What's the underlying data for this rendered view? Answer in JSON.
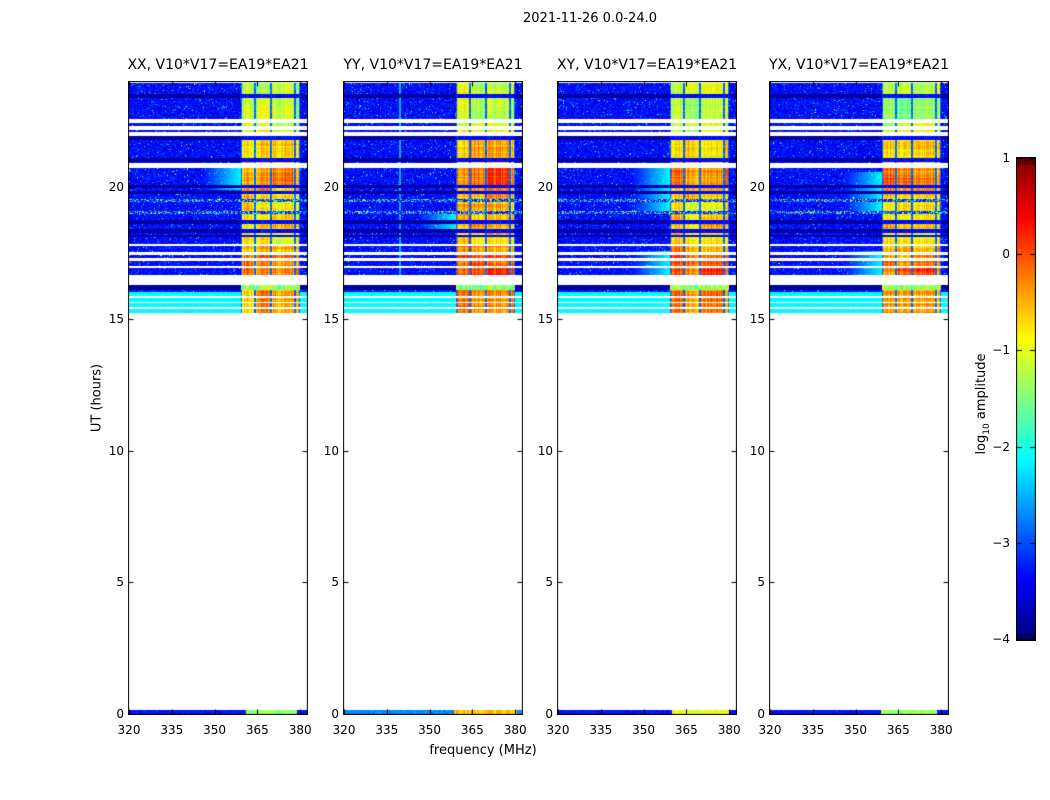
{
  "chart_data": {
    "type": "heatmap",
    "title": "2021-11-26 0.0-24.0",
    "xlabel": "frequency (MHz)",
    "ylabel": "UT (hours)",
    "panels": [
      {
        "label": "XX, V10*V17=EA19*EA21"
      },
      {
        "label": "YY, V10*V17=EA19*EA21"
      },
      {
        "label": "XY, V10*V17=EA19*EA21"
      },
      {
        "label": "YX, V10*V17=EA19*EA21"
      }
    ],
    "xlim": [
      320,
      382.4
    ],
    "ylim": [
      0,
      24
    ],
    "xticks": [
      320,
      335,
      350,
      365,
      380
    ],
    "yticks": [
      0,
      5,
      10,
      15,
      20
    ],
    "colorbar": {
      "label": "log10 amplitude",
      "lim": [
        -4,
        1
      ],
      "tick_values": [
        1,
        0,
        -1,
        -2,
        -3,
        -4
      ],
      "ticks": [
        "1",
        "0",
        "−1",
        "−2",
        "−3",
        "−4"
      ],
      "colormap": "jet"
    },
    "coverage_ut_hours": [
      [
        15.17,
        24.0
      ],
      [
        0,
        0.16
      ]
    ],
    "zero_hour_strip_ut": [
      0,
      0.15
    ],
    "rfi_band_mhz": [
      359.2,
      380.0
    ],
    "band_divider_mhz": [
      364.2,
      369.8,
      378.3
    ],
    "background_log_amp": -3.35,
    "white_gaps_ut": [
      [
        22.48,
        22.62
      ],
      [
        21.98,
        22.13
      ],
      [
        22.19,
        22.33
      ],
      [
        20.76,
        20.95
      ],
      [
        17.78,
        17.88
      ],
      [
        17.45,
        17.55
      ],
      [
        17.22,
        17.32
      ],
      [
        16.95,
        17.05
      ],
      [
        16.32,
        16.68
      ]
    ],
    "flagged_rows_ut": [
      [
        23.42,
        23.55
      ],
      [
        21.83,
        21.95
      ],
      [
        20.98,
        21.12
      ],
      [
        19.98,
        20.12
      ],
      [
        19.76,
        19.88
      ],
      [
        18.63,
        18.76
      ],
      [
        18.28,
        18.42
      ],
      [
        18.12,
        18.2
      ],
      [
        16.12,
        16.3
      ]
    ],
    "broadband_rfi_ut": [
      [
        19.47,
        19.58
      ],
      [
        19.0,
        19.12
      ]
    ],
    "striped_region_ut": [
      15.17,
      16.04
    ],
    "band_segments": [
      {
        "ut": [
          23.55,
          24.0
        ],
        "log_amp": -1.15
      },
      {
        "ut": [
          22.62,
          23.42
        ],
        "log_amp": -1.35
      },
      {
        "ut": [
          22.33,
          22.48
        ],
        "log_amp": -1.2
      },
      {
        "ut": [
          22.13,
          22.19
        ],
        "log_amp": -1.05
      },
      {
        "ut": [
          21.95,
          21.98
        ],
        "log_amp": -1.0
      },
      {
        "ut": [
          21.12,
          21.83
        ],
        "log_amp": -0.72
      },
      {
        "ut": [
          20.95,
          21.0
        ],
        "log_amp": -0.6
      },
      {
        "ut": [
          20.12,
          20.76
        ],
        "log_amp": -0.25
      },
      {
        "ut": [
          19.88,
          19.98
        ],
        "log_amp": -0.55
      },
      {
        "ut": [
          19.58,
          19.76
        ],
        "log_amp": -0.7
      },
      {
        "ut": [
          19.12,
          19.47
        ],
        "log_amp": -0.78
      },
      {
        "ut": [
          18.76,
          19.0
        ],
        "log_amp": -0.72
      },
      {
        "ut": [
          18.42,
          18.63
        ],
        "log_amp": -0.65
      },
      {
        "ut": [
          18.2,
          18.28
        ],
        "log_amp": -0.8
      },
      {
        "ut": [
          17.88,
          18.12
        ],
        "log_amp": -0.85
      },
      {
        "ut": [
          17.55,
          17.78
        ],
        "log_amp": -0.5
      },
      {
        "ut": [
          17.32,
          17.45
        ],
        "log_amp": -0.32
      },
      {
        "ut": [
          17.05,
          17.22
        ],
        "log_amp": -0.25
      },
      {
        "ut": [
          16.68,
          16.95
        ],
        "log_amp": -0.15
      },
      {
        "ut": [
          16.3,
          16.32
        ],
        "log_amp": -0.5
      },
      {
        "ut": [
          15.17,
          16.12
        ],
        "log_amp": -0.45
      },
      {
        "ut": [
          0,
          0.16
        ],
        "log_amp": -1.4
      }
    ],
    "panel_variants": [
      {
        "polarization": "XX",
        "band_adjust": 0,
        "vertical_streak_mhz": null,
        "bleed_ut": [
          [
            19.9,
            20.8
          ]
        ],
        "stripe_band_log_amp": -0.5,
        "strip0_band_mhz": [
          361,
          379
        ],
        "strip0_band_log_amp": -1.4,
        "strip0_bg_log_amp": -3.3
      },
      {
        "polarization": "YY",
        "band_adjust": 0.18,
        "vertical_streak_mhz": 339.7,
        "bleed_ut": [
          [
            18.4,
            19.0
          ]
        ],
        "stripe_band_log_amp": -0.2,
        "strip0_band_mhz": [
          358.5,
          380.5
        ],
        "strip0_band_log_amp": -0.55,
        "strip0_bg_log_amp": -2.7
      },
      {
        "polarization": "XY",
        "band_adjust": 0.05,
        "vertical_streak_mhz": null,
        "bleed_ut": [
          [
            19.0,
            20.8
          ],
          [
            16.68,
            17.6
          ]
        ],
        "stripe_band_log_amp": -0.35,
        "strip0_band_mhz": [
          360,
          380
        ],
        "strip0_band_log_amp": -1.0,
        "strip0_bg_log_amp": -3.3
      },
      {
        "polarization": "YX",
        "band_adjust": 0,
        "vertical_streak_mhz": null,
        "bleed_ut": [
          [
            19.0,
            20.6
          ],
          [
            16.68,
            17.6
          ]
        ],
        "stripe_band_log_amp": -0.4,
        "strip0_band_mhz": [
          359,
          378.5
        ],
        "strip0_band_log_amp": -1.35,
        "strip0_bg_log_amp": -3.3
      }
    ]
  },
  "colors": {
    "axis": "#000000",
    "background": "#ffffff"
  }
}
